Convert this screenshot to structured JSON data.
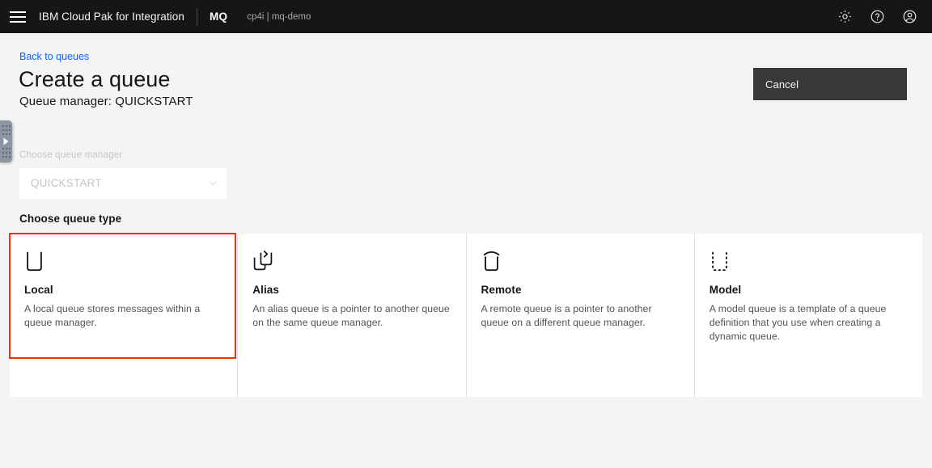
{
  "header": {
    "menu_icon": "hamburger-menu-icon",
    "product_name": "IBM Cloud Pak for Integration",
    "app_badge": "MQ",
    "namespace": "cp4i | mq-demo",
    "icons": [
      {
        "name": "settings-gear-icon",
        "label": "Settings"
      },
      {
        "name": "help-question-icon",
        "label": "Help"
      },
      {
        "name": "user-account-icon",
        "label": "Account"
      }
    ],
    "background_color": "#161616"
  },
  "page": {
    "back_link": "Back to queues",
    "title": "Create a queue",
    "subtitle": "Queue manager: QUICKSTART",
    "cancel_label": "Cancel",
    "background_color": "#f4f4f4",
    "link_color": "#0f62fe"
  },
  "edge_grip": {
    "name": "side-panel-grip-handle",
    "color": "#8d95a3"
  },
  "queue_manager_field": {
    "label": "Choose queue manager",
    "value": "QUICKSTART",
    "disabled": true,
    "chevron_icon": "chevron-down-icon"
  },
  "queue_type_section": {
    "heading": "Choose queue type",
    "selected": "Local",
    "highlight_color": "#fa2c0f",
    "cards": [
      {
        "id": "local",
        "icon": "queue-local-icon",
        "title": "Local",
        "description": "A local queue stores messages within a queue manager."
      },
      {
        "id": "alias",
        "icon": "queue-alias-icon",
        "title": "Alias",
        "description": "An alias queue is a pointer to another queue on the same queue manager."
      },
      {
        "id": "remote",
        "icon": "queue-remote-icon",
        "title": "Remote",
        "description": "A remote queue is a pointer to another queue on a different queue manager."
      },
      {
        "id": "model",
        "icon": "queue-model-icon",
        "title": "Model",
        "description": "A model queue is a template of a queue definition that you use when creating a dynamic queue."
      }
    ]
  }
}
